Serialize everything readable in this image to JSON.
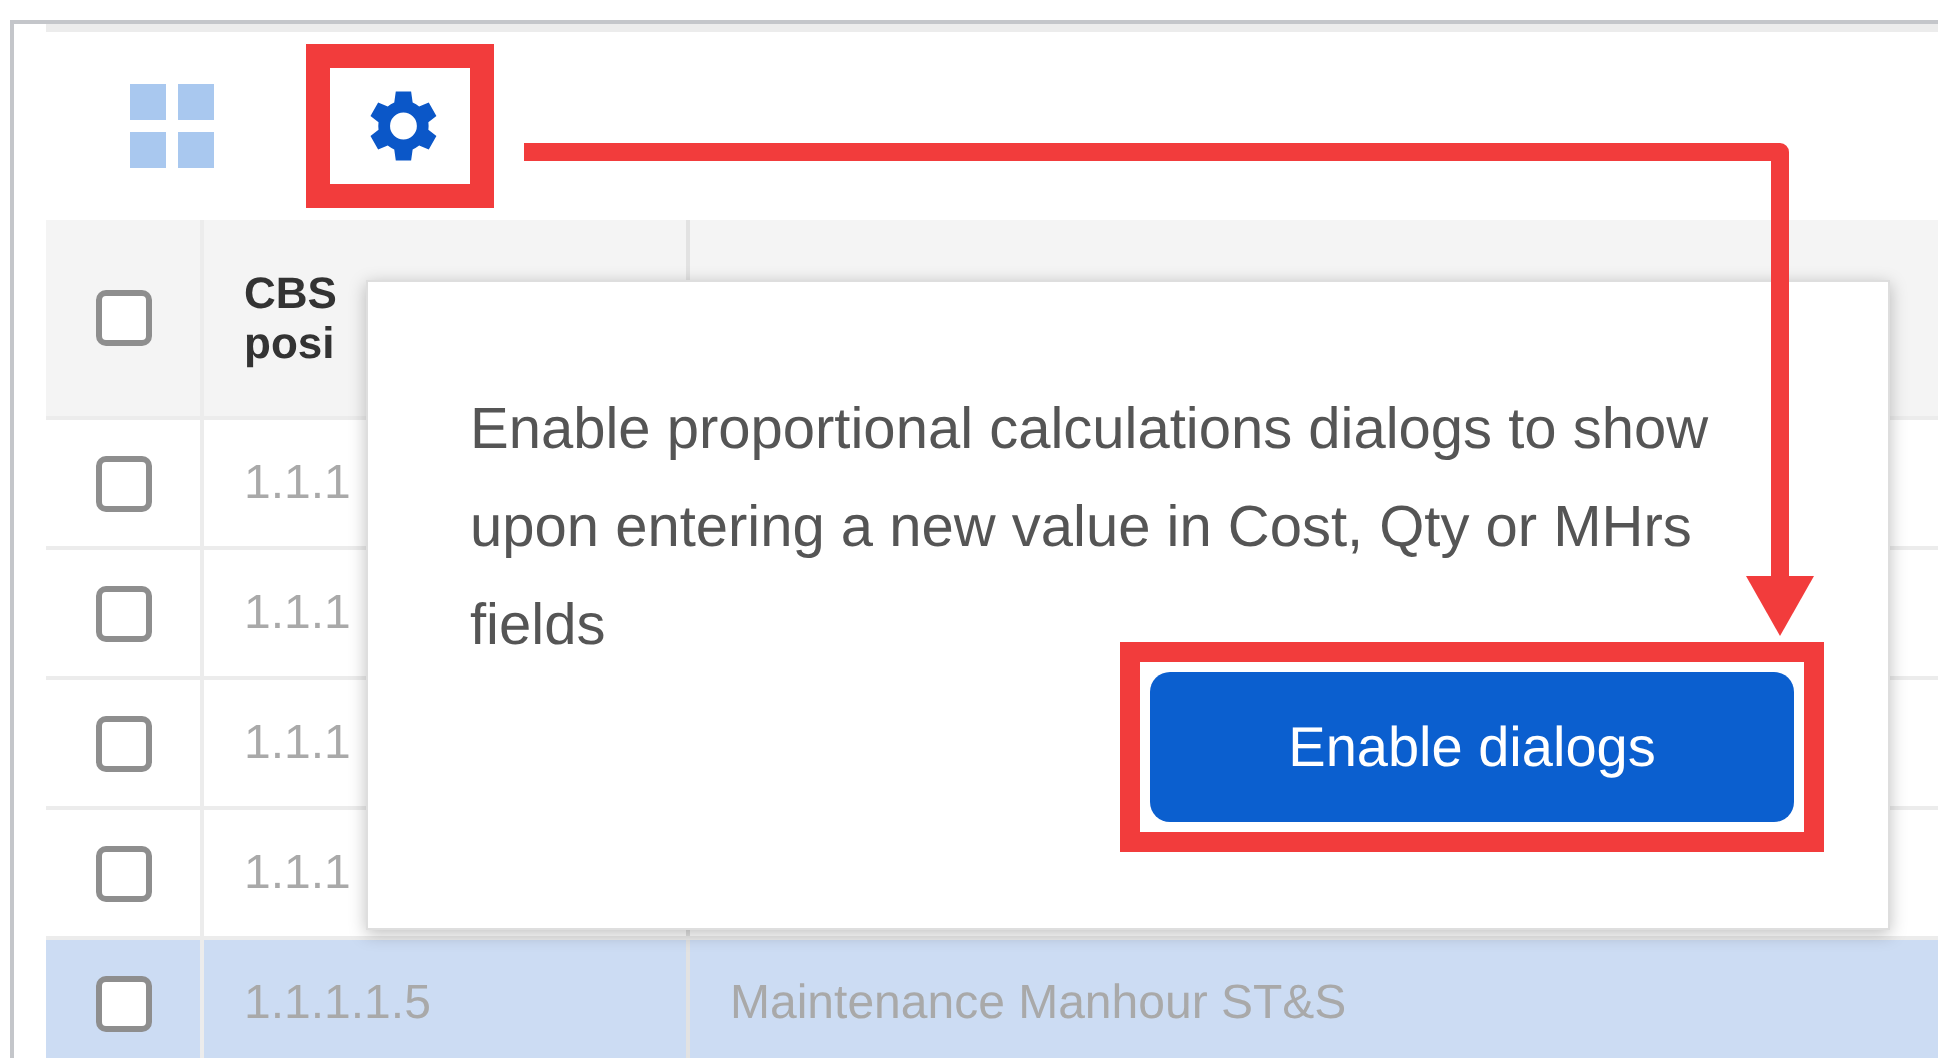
{
  "toolbar": [
    {
      "kind": "grid",
      "highlighted": false
    },
    {
      "kind": "settings",
      "highlighted": true
    }
  ],
  "table": {
    "select_all_checked": false,
    "columns": [
      "CBS posi"
    ],
    "rows": [
      {
        "cells": [
          "1.1.1"
        ],
        "checked": false,
        "selected": false
      },
      {
        "cells": [
          "1.1.1"
        ],
        "checked": false,
        "selected": false
      },
      {
        "cells": [
          "1.1.1"
        ],
        "checked": false,
        "selected": false
      },
      {
        "cells": [
          "1.1.1"
        ],
        "checked": false,
        "selected": false
      },
      {
        "cells": [
          "1.1.1.1.5",
          "Maintenance Manhour ST&S"
        ],
        "checked": false,
        "selected": true
      }
    ]
  },
  "popover": {
    "text": "Enable proportional calculations dialogs to show upon entering a new value in Cost, Qty or MHrs fields",
    "button": "Enable dialogs",
    "button_highlighted": true
  },
  "annotation_arrow": true
}
